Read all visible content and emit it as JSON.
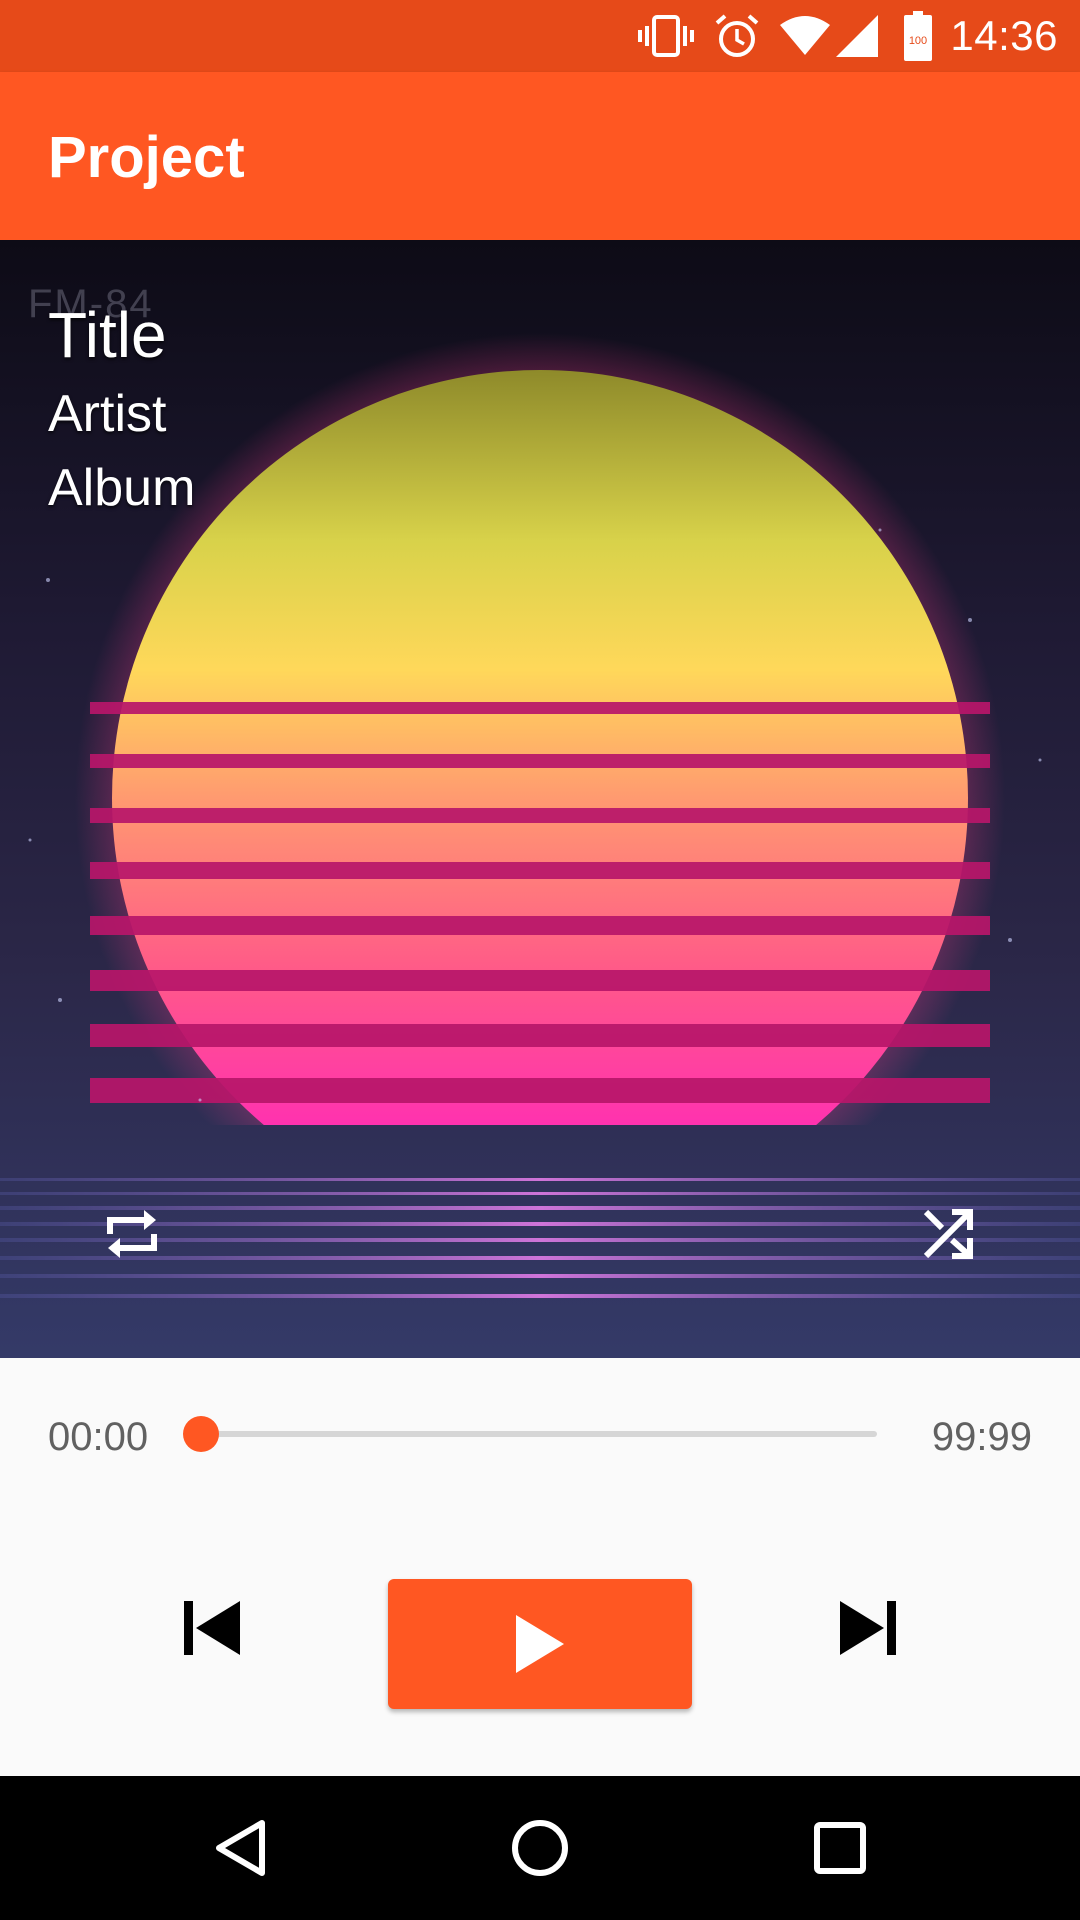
{
  "status_bar": {
    "time": "14:36",
    "battery_level": "100",
    "icons": [
      "vibrate-icon",
      "alarm-icon",
      "wifi-icon",
      "signal-icon",
      "battery-icon"
    ]
  },
  "app_bar": {
    "title": "Project"
  },
  "artwork": {
    "watermark": "FM-84",
    "track_title": "Title",
    "artist": "Artist",
    "album": "Album",
    "repeat_icon": "repeat-icon",
    "shuffle_icon": "shuffle-icon"
  },
  "playback": {
    "current_time": "00:00",
    "total_time": "99:99",
    "progress": 0
  },
  "controls": {
    "prev_icon": "skip-previous-icon",
    "play_icon": "play-icon",
    "next_icon": "skip-next-icon"
  },
  "nav_bar": {
    "icons": [
      "back-icon",
      "home-icon",
      "recents-icon"
    ]
  },
  "colors": {
    "accent": "#ff5722",
    "status_bar": "#e64a19",
    "background": "#fafafa",
    "nav_bar": "#000000"
  }
}
